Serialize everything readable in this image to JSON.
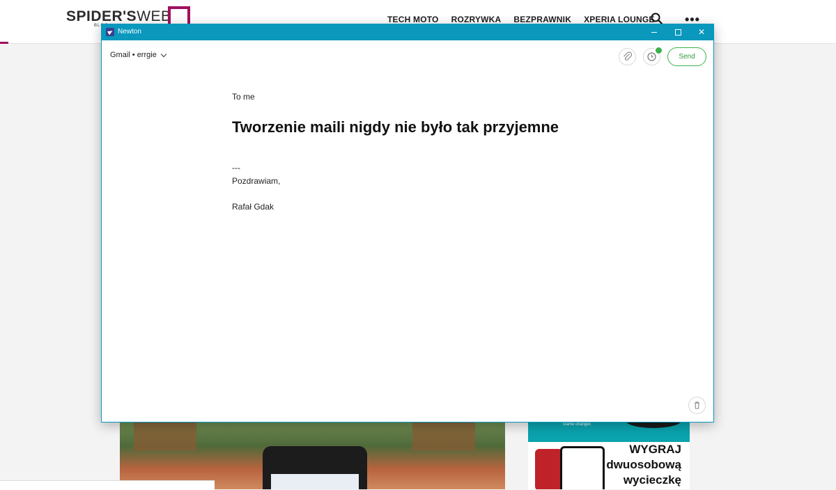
{
  "site": {
    "logo_bold": "SPIDER'S",
    "logo_thin": "WEB",
    "logo_sub": "BLOG",
    "nav": [
      "TECH MOTO",
      "ROZRYWKA",
      "BEZPRAWNIK",
      "XPERIA LOUNGE"
    ],
    "more_label": "•••",
    "accent_color": "#a0105e",
    "ad": {
      "tagline": "Game changer.",
      "title_lines": [
        "WYGRAJ",
        "dwuosobową",
        "wycieczkę"
      ]
    }
  },
  "window": {
    "app_title": "Newton",
    "title_color": "#0a98bd",
    "controls": {
      "minimize": "minimize",
      "maximize": "maximize",
      "close": "✕"
    }
  },
  "composer": {
    "account": "Gmail • errgie",
    "send_label": "Send",
    "send_color": "#3bb24a",
    "to_line": "To me",
    "subject": "Tworzenie maili nigdy nie było tak przyjemne",
    "signature": {
      "dash": "---",
      "greeting": "Pozdrawiam,",
      "name": "Rafał Gdak"
    },
    "icons": [
      "paperclip-icon",
      "clock-icon",
      "trash-icon"
    ]
  }
}
